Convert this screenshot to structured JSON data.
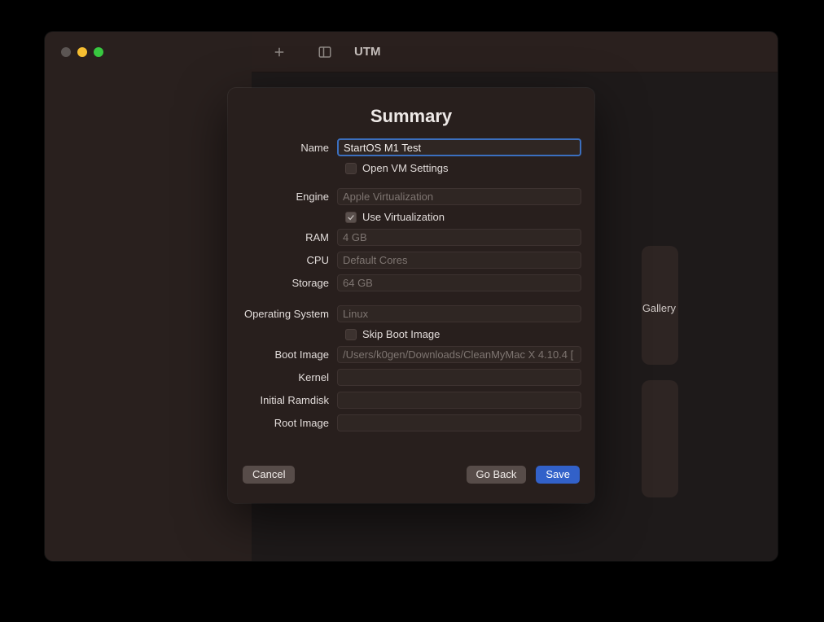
{
  "toolbar": {
    "title": "UTM"
  },
  "sheet": {
    "title": "Summary",
    "labels": {
      "name": "Name",
      "engine": "Engine",
      "ram": "RAM",
      "cpu": "CPU",
      "storage": "Storage",
      "os": "Operating System",
      "boot_image": "Boot Image",
      "kernel": "Kernel",
      "ramdisk": "Initial Ramdisk",
      "root_image": "Root Image"
    },
    "values": {
      "name": "StartOS M1 Test",
      "engine": "Apple Virtualization",
      "ram": "4 GB",
      "cpu": "Default Cores",
      "storage": "64 GB",
      "os": "Linux",
      "boot_image": "/Users/k0gen/Downloads/CleanMyMac X 4.10.4 [",
      "kernel": "",
      "ramdisk": "",
      "root_image": ""
    },
    "checkboxes": {
      "open_vm_settings": "Open VM Settings",
      "use_virtualization": "Use Virtualization",
      "skip_boot_image": "Skip Boot Image"
    },
    "buttons": {
      "cancel": "Cancel",
      "go_back": "Go Back",
      "save": "Save"
    }
  },
  "gallery_text": "Gallery"
}
